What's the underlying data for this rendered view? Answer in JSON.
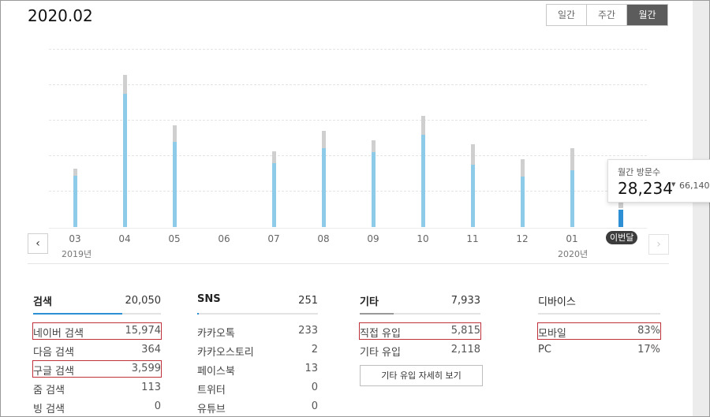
{
  "page": {
    "period_title": "2020.02"
  },
  "period_tabs": [
    {
      "label": "일간",
      "active": false
    },
    {
      "label": "주간",
      "active": false
    },
    {
      "label": "월간",
      "active": true
    }
  ],
  "chart_data": {
    "type": "bar",
    "categories": [
      "03",
      "04",
      "05",
      "06",
      "07",
      "08",
      "09",
      "10",
      "11",
      "12",
      "01",
      "이번달"
    ],
    "year_labels": [
      {
        "label": "2019년",
        "at": "03"
      },
      {
        "label": "2020년",
        "at": "01"
      }
    ],
    "series": [
      {
        "values": [
          null,
          null,
          null,
          null,
          null,
          null,
          null,
          null,
          null,
          null,
          null,
          null
        ]
      }
    ],
    "visitors_blue": [
      0.38,
      0.98,
      0.63,
      0.0,
      0.47,
      0.58,
      0.55,
      0.68,
      0.46,
      0.37,
      0.42,
      0.14
    ],
    "visitors_gray": [
      0.05,
      0.14,
      0.12,
      0.0,
      0.09,
      0.13,
      0.09,
      0.14,
      0.15,
      0.13,
      0.16,
      0.04
    ],
    "ylim": [
      0,
      1
    ],
    "grid": true,
    "current_index": 11
  },
  "tooltip": {
    "label": "월간 방문수",
    "value": "28,234",
    "prev_value": "66,140"
  },
  "nav": {
    "prev_glyph": "‹",
    "next_glyph": "›"
  },
  "stats": {
    "search": {
      "title": "검색",
      "total": "20,050",
      "bar_fraction": 0.71,
      "rows": [
        {
          "label": "네이버 검색",
          "value": "15,974",
          "highlight": true
        },
        {
          "label": "다음 검색",
          "value": "364",
          "highlight": false
        },
        {
          "label": "구글 검색",
          "value": "3,599",
          "highlight": true
        },
        {
          "label": "줌 검색",
          "value": "113",
          "highlight": false
        },
        {
          "label": "빙 검색",
          "value": "0",
          "highlight": false
        }
      ]
    },
    "sns": {
      "title": "SNS",
      "total": "251",
      "bar_fraction": 0.01,
      "rows": [
        {
          "label": "카카오톡",
          "value": "233",
          "highlight": false
        },
        {
          "label": "카카오스토리",
          "value": "2",
          "highlight": false
        },
        {
          "label": "페이스북",
          "value": "13",
          "highlight": false
        },
        {
          "label": "트위터",
          "value": "0",
          "highlight": false
        },
        {
          "label": "유튜브",
          "value": "0",
          "highlight": false
        }
      ]
    },
    "etc": {
      "title": "기타",
      "total": "7,933",
      "bar_fraction": 0.28,
      "rows": [
        {
          "label": "직접 유입",
          "value": "5,815",
          "highlight": true
        },
        {
          "label": "기타 유입",
          "value": "2,118",
          "highlight": false
        }
      ],
      "detail_button": "기타 유입 자세히 보기"
    },
    "device": {
      "title": "디바이스",
      "total": "",
      "bar_fraction": 0,
      "rows": [
        {
          "label": "모바일",
          "value": "83%",
          "highlight": true
        },
        {
          "label": "PC",
          "value": "17%",
          "highlight": false
        }
      ]
    }
  }
}
